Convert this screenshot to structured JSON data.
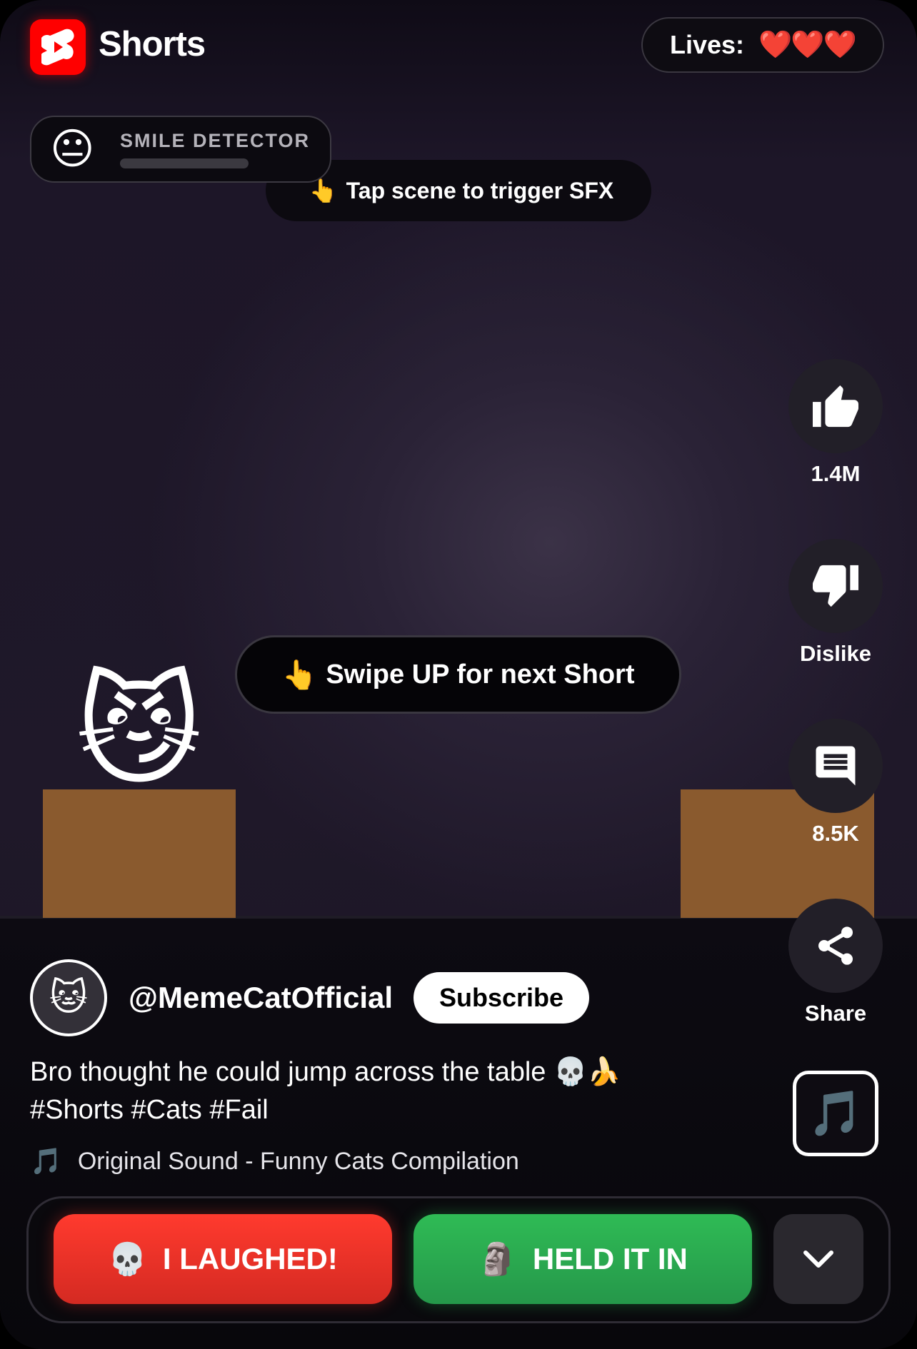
{
  "header": {
    "app_title": "Shorts",
    "logo_icon": "shorts-logo-icon",
    "brand_color": "#ff0000",
    "lives_label": "Lives:",
    "lives_hearts": "❤️❤️❤️",
    "lives_count": 3
  },
  "smile_detector": {
    "face": "😐",
    "label": "SMILE DETECTOR",
    "level": 0
  },
  "hints": {
    "tap_hand": "👆",
    "tap_text": "Tap scene to trigger SFX",
    "swipe_hand": "👆",
    "swipe_text": "Swipe UP for next Short"
  },
  "scene": {
    "character": "😼",
    "table_color": "#8a5a2e"
  },
  "actions": {
    "like": {
      "icon": "thumbs-up-icon",
      "label": "1.4M"
    },
    "dislike": {
      "icon": "thumbs-down-icon",
      "label": "Dislike"
    },
    "comments": {
      "icon": "comment-icon",
      "label": "8.5K"
    },
    "share": {
      "icon": "share-icon",
      "label": "Share"
    },
    "sound": {
      "icon": "music-note-icon",
      "glyph": "🎵"
    }
  },
  "channel": {
    "avatar": "🐱",
    "name": "@MemeCatOfficial",
    "subscribe_label": "Subscribe"
  },
  "caption": {
    "line1": "Bro thought he could jump across the table 💀🍌",
    "line2": "#Shorts #Cats #Fail"
  },
  "sound": {
    "note": "🎵",
    "text": "Original Sound - Funny Cats Compilation"
  },
  "bottom_bar": {
    "laughed_emoji": "💀",
    "laughed_label": "I LAUGHED!",
    "laughed_color": "#ff3a2e",
    "held_emoji": "🗿",
    "held_label": "HELD IT IN",
    "held_color": "#2fbb55",
    "more_icon": "chevron-down-icon"
  }
}
